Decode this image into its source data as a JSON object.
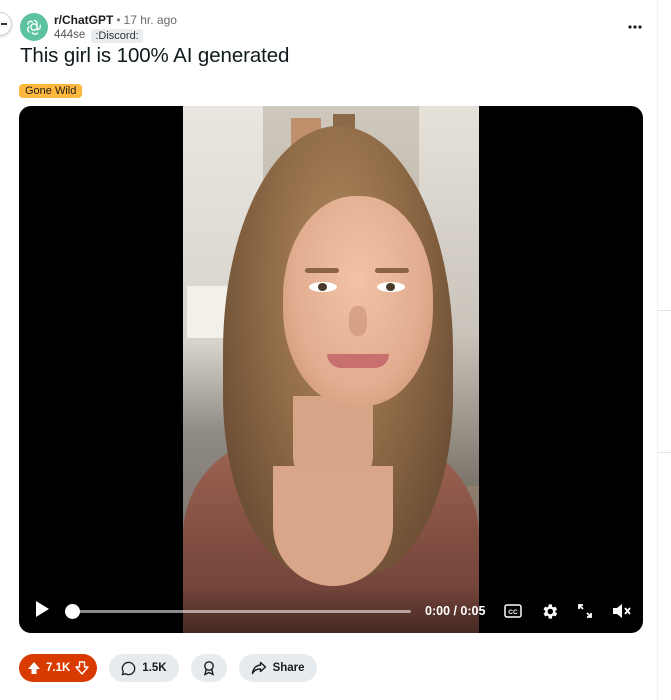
{
  "post": {
    "subreddit": "r/ChatGPT",
    "separator": "•",
    "time_ago": "17 hr. ago",
    "author": "444se",
    "user_flair": ":Discord:",
    "title": "This girl is 100% AI generated",
    "post_flair": "Gone Wild"
  },
  "player": {
    "time_display": "0:00 / 0:05",
    "progress": 0.0
  },
  "actions": {
    "upvotes": "7.1K",
    "comments": "1.5K",
    "share_label": "Share"
  },
  "colors": {
    "upvote_active": "#d93a00",
    "flair": "#ffb83d",
    "pill_bg": "#e5ebee",
    "subreddit_avatar": "#5dc29f"
  },
  "icons": [
    "chatgpt-logo-icon",
    "more-options-icon",
    "play-icon",
    "closed-captions-icon",
    "settings-gear-icon",
    "fullscreen-icon",
    "mute-icon",
    "upvote-icon",
    "downvote-icon",
    "comment-icon",
    "award-icon",
    "share-icon"
  ]
}
